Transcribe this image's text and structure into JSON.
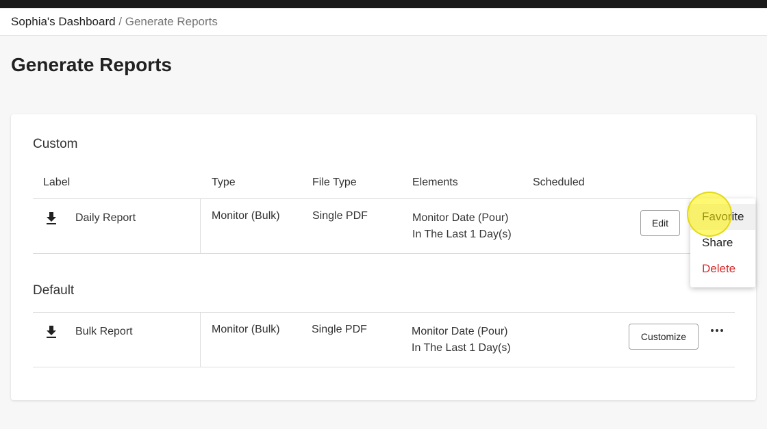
{
  "breadcrumb": {
    "home": "Sophia's Dashboard",
    "separator": " / ",
    "current": "Generate Reports"
  },
  "page": {
    "title": "Generate Reports"
  },
  "table": {
    "columns": {
      "label": "Label",
      "type": "Type",
      "file_type": "File Type",
      "elements": "Elements",
      "scheduled": "Scheduled"
    }
  },
  "sections": {
    "custom": {
      "title": "Custom",
      "rows": [
        {
          "icon": "download-icon",
          "label": "Daily Report",
          "type": "Monitor (Bulk)",
          "file_type": "Single PDF",
          "elements_line1": "Monitor Date (Pour)",
          "elements_line2": "In The Last 1 Day(s)",
          "scheduled": "",
          "action_label": "Edit"
        }
      ]
    },
    "default": {
      "title": "Default",
      "rows": [
        {
          "icon": "download-icon",
          "label": "Bulk Report",
          "type": "Monitor (Bulk)",
          "file_type": "Single PDF",
          "elements_line1": "Monitor Date (Pour)",
          "elements_line2": "In The Last 1 Day(s)",
          "scheduled": "",
          "action_label": "Customize",
          "more_icon": "more-horizontal-icon"
        }
      ]
    }
  },
  "row_menu": {
    "items": [
      {
        "label": "Favorite",
        "state": "hover"
      },
      {
        "label": "Share",
        "state": "normal"
      },
      {
        "label": "Delete",
        "state": "danger",
        "color": "#d32f2f"
      }
    ]
  },
  "colors": {
    "background": "#f7f7f7",
    "top_bar": "#1a1a1a",
    "danger": "#d32f2f",
    "cursor_highlight": "#fff300"
  }
}
